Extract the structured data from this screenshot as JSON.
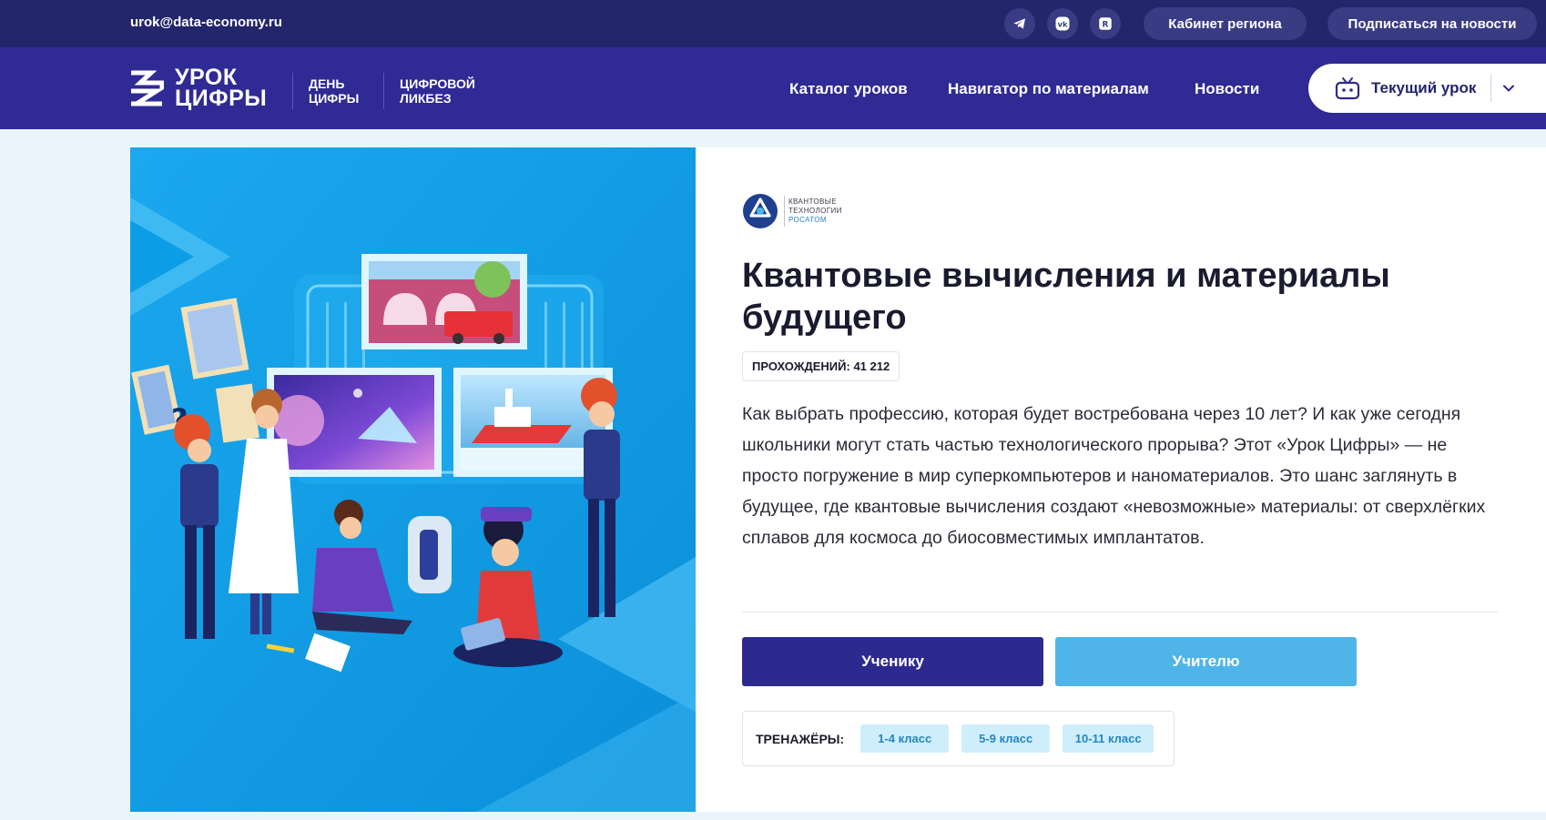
{
  "topbar": {
    "email": "urok@data-economy.ru",
    "social": [
      "telegram-icon",
      "vk-icon",
      "rutube-icon"
    ],
    "region_cabinet": "Кабинет региона",
    "subscribe": "Подписаться на новости"
  },
  "header": {
    "logo_line1": "УРОК",
    "logo_line2": "ЦИФРЫ",
    "den_line1": "ДЕНЬ",
    "den_line2": "ЦИФРЫ",
    "likbez_line1": "ЦИФРОВОЙ",
    "likbez_line2": "ЛИКБЕЗ",
    "nav": [
      "Каталог уроков",
      "Навигатор по материалам",
      "Новости"
    ],
    "current_lesson": "Текущий урок"
  },
  "lesson": {
    "partner_line1": "КВАНТОВЫЕ",
    "partner_line2": "ТЕХНОЛОГИИ",
    "partner_line3": "РОСАТОМ",
    "title": "Квантовые вычисления и материалы будущего",
    "completions_label": "ПРОХОЖДЕНИЙ:",
    "completions_value": "41 212",
    "description": "Как выбрать профессию, которая будет востребована через 10 лет? И как уже сегодня школьники могут стать частью технологического прорыва? Этот «Урок Цифры» — не просто погружение в мир суперкомпьютеров и наноматериалов. Это шанс заглянуть в будущее, где квантовые вычисления создают «невозможные» материалы: от сверхлёгких сплавов для космоса до биосовместимых имплантатов.",
    "student_button": "Ученику",
    "teacher_button": "Учителю",
    "trainers_label": "ТРЕНАЖЁРЫ:",
    "trainers": [
      "1-4 класс",
      "5-9 класс",
      "10-11 класс"
    ]
  },
  "colors": {
    "topbar": "#23266b",
    "header": "#2f2a94",
    "hero_blue": "#0b9ee6",
    "student_button": "#2d2a8f",
    "teacher_button": "#4fb5e8",
    "chip_bg": "#cfeefb"
  }
}
